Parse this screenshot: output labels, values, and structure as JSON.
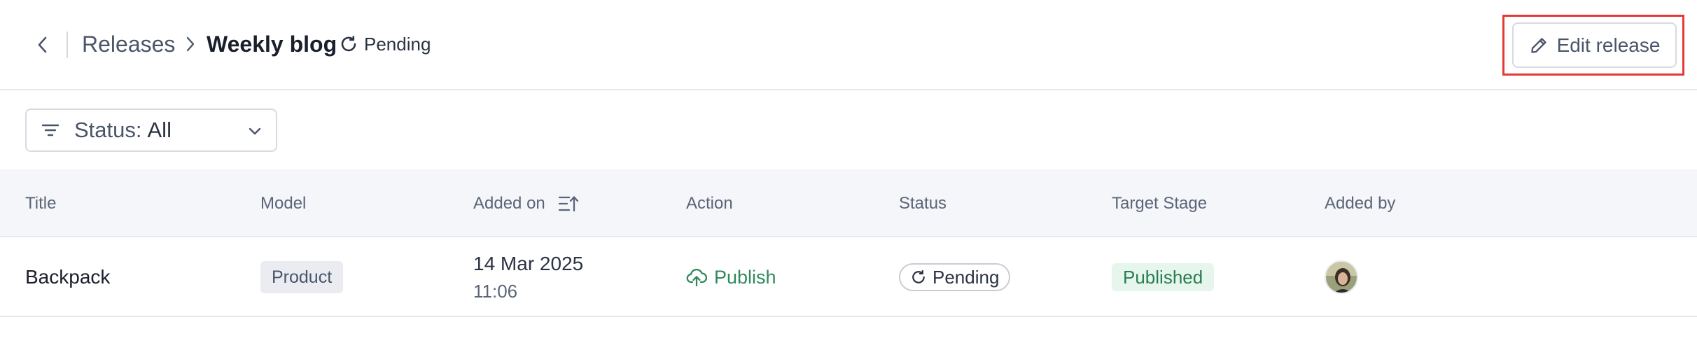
{
  "header": {
    "breadcrumb_parent": "Releases",
    "breadcrumb_current": "Weekly blog",
    "status": "Pending",
    "edit_button_label": "Edit release"
  },
  "filter": {
    "label": "Status:",
    "value": "All"
  },
  "table": {
    "columns": [
      "Title",
      "Model",
      "Added on",
      "Action",
      "Status",
      "Target Stage",
      "Added by"
    ],
    "rows": [
      {
        "title": "Backpack",
        "model": "Product",
        "added_on_date": "14 Mar 2025",
        "added_on_time": "11:06",
        "action": "Publish",
        "status": "Pending",
        "target_stage": "Published"
      }
    ]
  },
  "icons": {
    "back": "chevron-left-icon",
    "breadcrumb_separator": "chevron-right-icon",
    "status": "loader-circle-icon",
    "edit": "pencil-icon",
    "filter": "filter-lines-icon",
    "dropdown": "chevron-down-icon",
    "sort": "sort-ascending-icon",
    "action": "cloud-upload-icon"
  },
  "colors": {
    "accent_green": "#2e8a5c",
    "stage_badge_bg": "#e6f6ec",
    "focus_outline": "#e53a33",
    "header_bg": "#f5f6fa"
  }
}
